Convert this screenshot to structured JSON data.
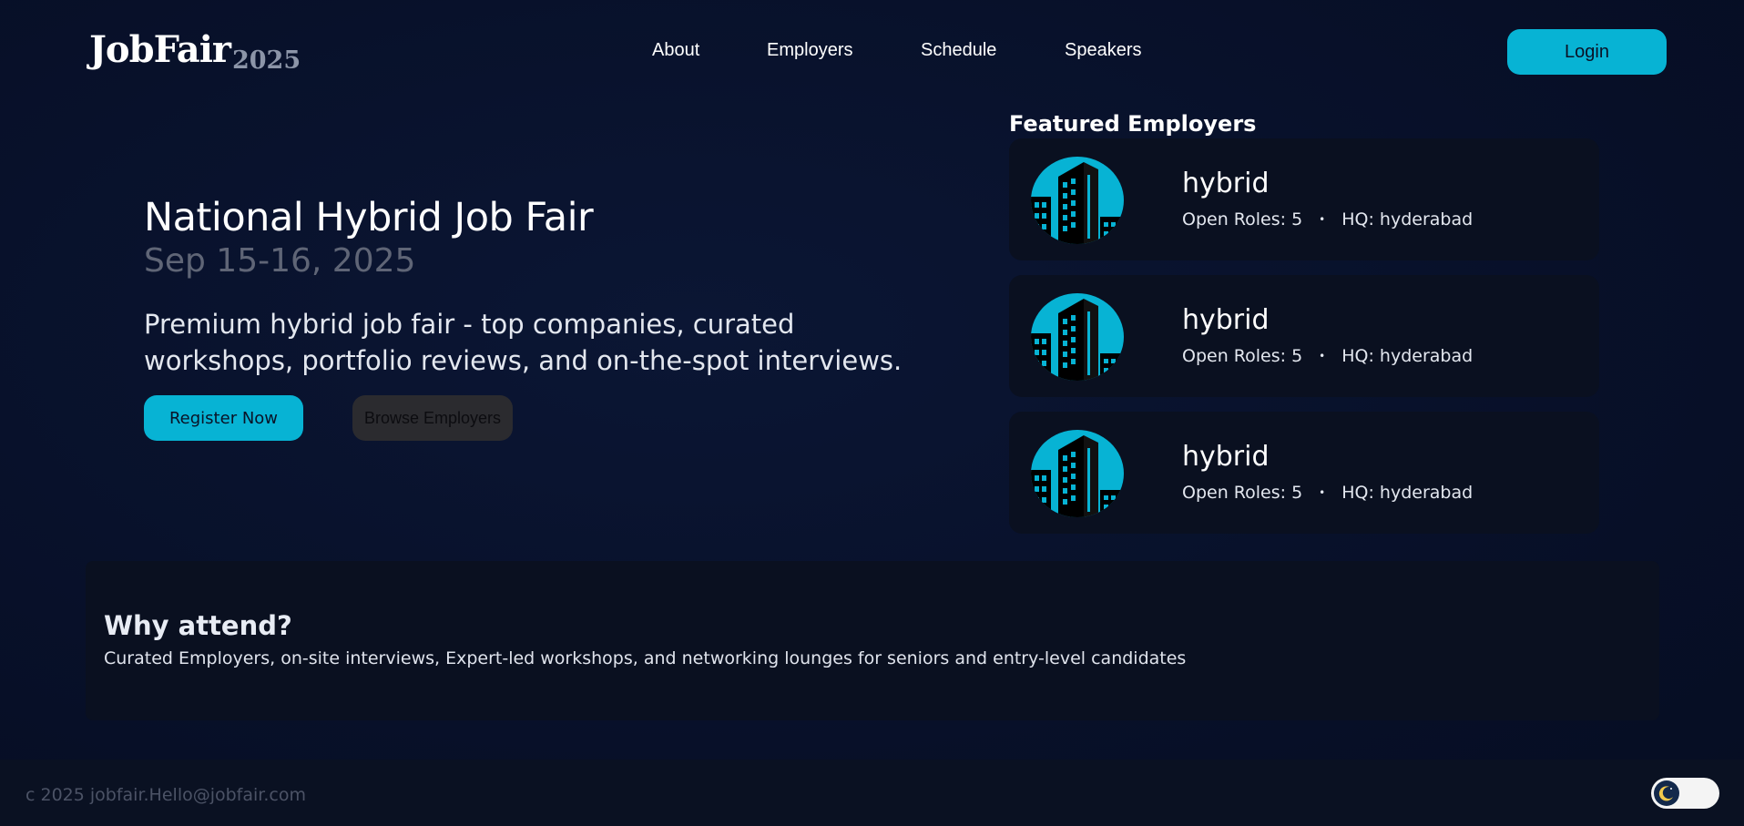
{
  "nav": {
    "logo_main": "JobFair",
    "logo_year": "2025",
    "links": [
      {
        "label": "About"
      },
      {
        "label": "Employers"
      },
      {
        "label": "Schedule"
      },
      {
        "label": "Speakers"
      }
    ],
    "login_label": "Login"
  },
  "hero": {
    "title": "National Hybrid Job Fair",
    "date": "Sep 15-16, 2025",
    "description": "Premium hybrid job fair - top companies, curated workshops, portfolio reviews, and on-the-spot interviews.",
    "register_label": "Register Now",
    "browse_label": "Browse Employers"
  },
  "featured": {
    "title": "Featured Employers",
    "employers": [
      {
        "name": "hybrid",
        "open_roles": "Open Roles: 5",
        "separator": "•",
        "hq": "HQ: hyderabad",
        "icon": "building-icon"
      },
      {
        "name": "hybrid",
        "open_roles": "Open Roles: 5",
        "separator": "•",
        "hq": "HQ: hyderabad",
        "icon": "building-icon"
      },
      {
        "name": "hybrid",
        "open_roles": "Open Roles: 5",
        "separator": "•",
        "hq": "HQ: hyderabad",
        "icon": "building-icon"
      }
    ]
  },
  "why": {
    "title": "Why attend?",
    "text": "Curated Employers, on-site interviews, Expert-led workshops, and networking lounges for seniors and entry-level candidates"
  },
  "footer": {
    "copyright": "c 2025 jobfair.Hello@jobfair.com",
    "theme_toggle_icon": "moon-icon"
  },
  "colors": {
    "accent": "#07b3d4",
    "background": "#07102a",
    "card": "#0a1020",
    "secondary_button": "#2b2b2f"
  }
}
